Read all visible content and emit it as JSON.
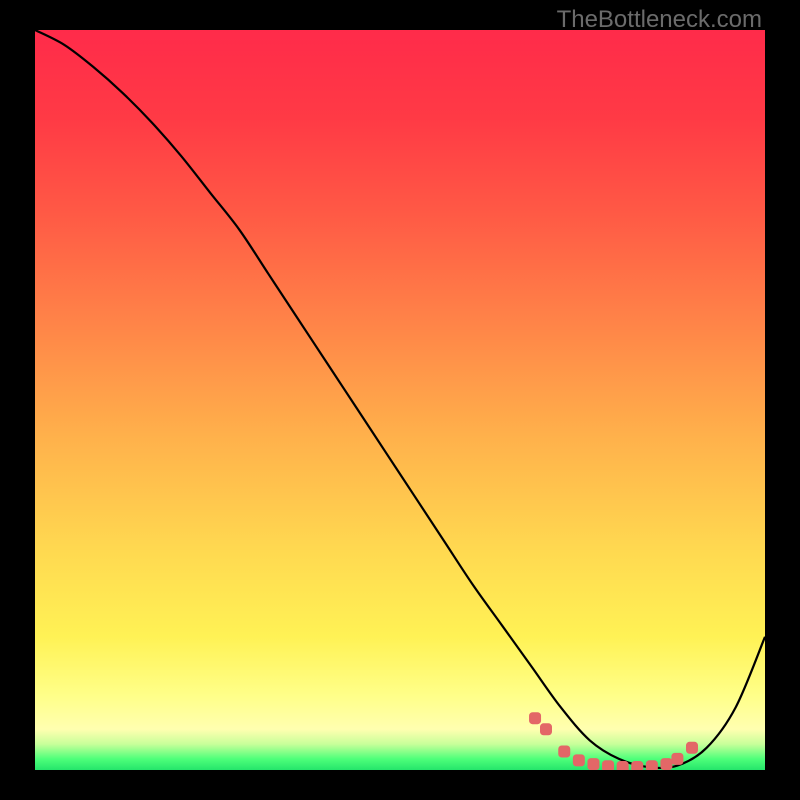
{
  "watermark": "TheBottleneck.com",
  "chart_data": {
    "type": "line",
    "title": "",
    "xlabel": "",
    "ylabel": "",
    "xlim": [
      0,
      100
    ],
    "ylim": [
      0,
      100
    ],
    "grid": false,
    "series": [
      {
        "name": "curve",
        "color": "#000000",
        "x": [
          0,
          4,
          8,
          12,
          16,
          20,
          24,
          28,
          32,
          36,
          40,
          44,
          48,
          52,
          56,
          60,
          64,
          68,
          72,
          76,
          80,
          84,
          88,
          92,
          96,
          100
        ],
        "y": [
          100,
          98,
          95,
          91.5,
          87.5,
          83,
          78,
          73,
          67,
          61,
          55,
          49,
          43,
          37,
          31,
          25,
          19.5,
          14,
          8.5,
          4,
          1.5,
          0.4,
          0.6,
          3,
          8.5,
          18
        ]
      }
    ],
    "markers": {
      "color": "#e36767",
      "points": [
        {
          "x": 68.5,
          "y": 7.0
        },
        {
          "x": 70.0,
          "y": 5.5
        },
        {
          "x": 72.5,
          "y": 2.5
        },
        {
          "x": 74.5,
          "y": 1.3
        },
        {
          "x": 76.5,
          "y": 0.8
        },
        {
          "x": 78.5,
          "y": 0.5
        },
        {
          "x": 80.5,
          "y": 0.4
        },
        {
          "x": 82.5,
          "y": 0.4
        },
        {
          "x": 84.5,
          "y": 0.5
        },
        {
          "x": 86.5,
          "y": 0.8
        },
        {
          "x": 88.0,
          "y": 1.5
        },
        {
          "x": 90.0,
          "y": 3.0
        }
      ]
    },
    "gradient_stops": [
      {
        "offset": 0.0,
        "color": "#ff2b4a"
      },
      {
        "offset": 0.12,
        "color": "#ff3a45"
      },
      {
        "offset": 0.25,
        "color": "#ff5a45"
      },
      {
        "offset": 0.4,
        "color": "#ff8548"
      },
      {
        "offset": 0.55,
        "color": "#ffb14b"
      },
      {
        "offset": 0.7,
        "color": "#ffd850"
      },
      {
        "offset": 0.82,
        "color": "#fff255"
      },
      {
        "offset": 0.9,
        "color": "#ffff89"
      },
      {
        "offset": 0.945,
        "color": "#ffffb0"
      },
      {
        "offset": 0.965,
        "color": "#c8ff9a"
      },
      {
        "offset": 0.985,
        "color": "#4eff7a"
      },
      {
        "offset": 1.0,
        "color": "#25e56b"
      }
    ]
  }
}
